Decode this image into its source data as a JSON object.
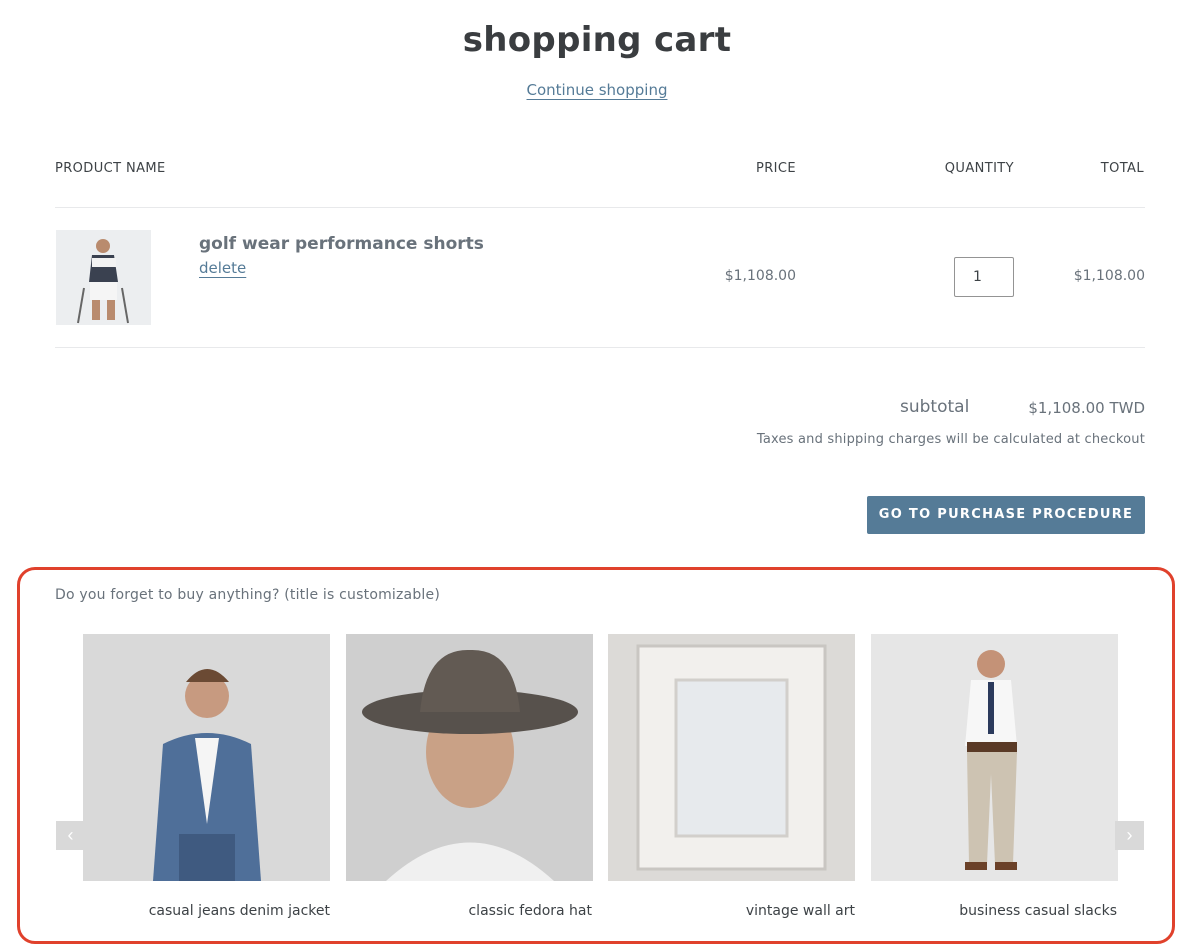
{
  "page": {
    "title": "shopping cart",
    "continue_label": "Continue shopping"
  },
  "table": {
    "headers": {
      "product": "PRODUCT NAME",
      "price": "PRICE",
      "quantity": "QUANTITY",
      "total": "TOTAL"
    }
  },
  "cart": {
    "items": [
      {
        "title": "golf wear performance shorts",
        "delete_label": "delete",
        "price": "$1,108.00",
        "quantity": "1",
        "total": "$1,108.00"
      }
    ]
  },
  "summary": {
    "subtotal_label": "subtotal",
    "subtotal_value": "$1,108.00 TWD",
    "tax_note": "Taxes and shipping charges will be calculated at checkout",
    "checkout_label": "GO TO PURCHASE PROCEDURE"
  },
  "recommendations": {
    "title": "Do you forget to buy anything? (title is customizable)",
    "products": [
      {
        "label": "casual jeans denim jacket"
      },
      {
        "label": "classic fedora hat"
      },
      {
        "label": "vintage wall art"
      },
      {
        "label": "business casual slacks"
      }
    ],
    "prev_icon": "chevron-left-icon",
    "next_icon": "chevron-right-icon"
  },
  "colors": {
    "accent": "#557b97",
    "highlight": "#e0412c"
  }
}
